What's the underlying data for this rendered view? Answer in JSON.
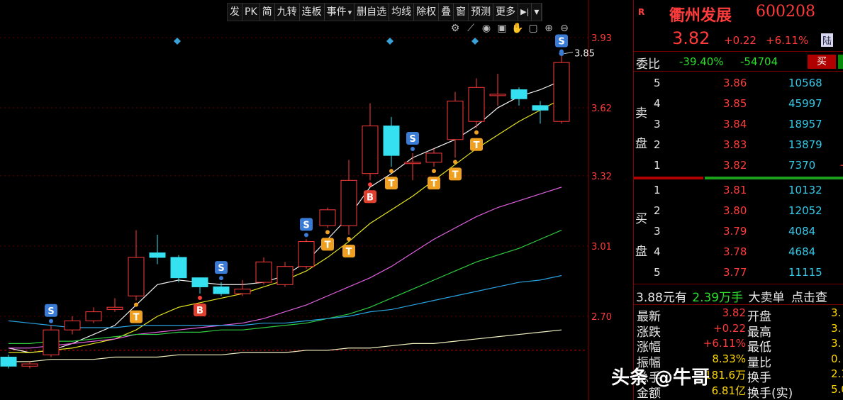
{
  "toolbar": {
    "items": [
      "发",
      "PK",
      "简",
      "九转",
      "连板",
      "事件",
      "删自选",
      "均线",
      "除权",
      "叠",
      "窗",
      "预测",
      "更多"
    ],
    "menu_icon": "dropdown-triangle-icon",
    "collapse_icon": "collapse-right-icon"
  },
  "chart_icons": [
    "gear-icon",
    "brush-icon",
    "eye-icon",
    "case-icon",
    "hand-icon",
    "lock-icon",
    "zoom-in-icon",
    "zoom-out-icon"
  ],
  "chart_data": {
    "type": "candlestick",
    "y_ticks": [
      "3.93",
      "3.62",
      "3.32",
      "3.01",
      "2.70"
    ],
    "ylim": [
      2.45,
      4.05
    ],
    "ref_price": 2.55,
    "high_label": "3.85",
    "colors": {
      "up": "#ff3b3b",
      "down": "#35e0f0",
      "background": "#000000",
      "grid": "#5a0000"
    },
    "candles": [
      [
        2.52,
        2.48,
        2.53,
        2.47
      ],
      [
        2.48,
        2.49,
        2.5,
        2.47
      ],
      [
        2.53,
        2.64,
        2.66,
        2.52
      ],
      [
        2.64,
        2.68,
        2.7,
        2.62
      ],
      [
        2.68,
        2.72,
        2.74,
        2.67
      ],
      [
        2.73,
        2.74,
        2.78,
        2.72
      ],
      [
        2.79,
        2.96,
        3.08,
        2.77
      ],
      [
        2.98,
        2.96,
        3.06,
        2.93
      ],
      [
        2.96,
        2.87,
        2.97,
        2.85
      ],
      [
        2.87,
        2.83,
        2.87,
        2.8
      ],
      [
        2.83,
        2.8,
        2.85,
        2.79
      ],
      [
        2.8,
        2.82,
        2.86,
        2.79
      ],
      [
        2.85,
        2.94,
        2.96,
        2.84
      ],
      [
        2.84,
        2.92,
        2.94,
        2.83
      ],
      [
        2.92,
        3.03,
        3.04,
        2.91
      ],
      [
        3.1,
        3.17,
        3.18,
        3.09
      ],
      [
        3.1,
        3.3,
        3.39,
        3.06
      ],
      [
        3.33,
        3.54,
        3.64,
        3.3
      ],
      [
        3.54,
        3.41,
        3.58,
        3.36
      ],
      [
        3.38,
        3.38,
        3.42,
        3.3
      ],
      [
        3.38,
        3.42,
        3.44,
        3.36
      ],
      [
        3.48,
        3.65,
        3.69,
        3.4
      ],
      [
        3.56,
        3.71,
        3.75,
        3.53
      ],
      [
        3.68,
        3.68,
        3.77,
        3.63
      ],
      [
        3.7,
        3.66,
        3.71,
        3.63
      ],
      [
        3.63,
        3.61,
        3.65,
        3.55
      ],
      [
        3.56,
        3.82,
        3.85,
        3.55
      ]
    ],
    "ma_series": [
      {
        "color": "#f2f2f2",
        "values": [
          2.56,
          2.54,
          2.55,
          2.58,
          2.62,
          2.66,
          2.75,
          2.84,
          2.86,
          2.85,
          2.84,
          2.84,
          2.85,
          2.88,
          2.94,
          3.04,
          3.14,
          3.27,
          3.33,
          3.4,
          3.44,
          3.48,
          3.54,
          3.62,
          3.67,
          3.7,
          3.74
        ]
      },
      {
        "color": "#e6e61e",
        "values": [
          2.54,
          2.54,
          2.55,
          2.56,
          2.58,
          2.6,
          2.64,
          2.7,
          2.74,
          2.76,
          2.78,
          2.8,
          2.83,
          2.86,
          2.9,
          2.96,
          3.03,
          3.11,
          3.17,
          3.23,
          3.3,
          3.37,
          3.44,
          3.5,
          3.56,
          3.61,
          3.66
        ]
      },
      {
        "color": "#e060e0",
        "values": [
          2.56,
          2.56,
          2.57,
          2.58,
          2.59,
          2.6,
          2.62,
          2.63,
          2.64,
          2.65,
          2.66,
          2.67,
          2.69,
          2.72,
          2.75,
          2.79,
          2.83,
          2.87,
          2.92,
          2.98,
          3.04,
          3.09,
          3.14,
          3.18,
          3.21,
          3.24,
          3.27
        ]
      },
      {
        "color": "#2ecc40",
        "values": [
          2.58,
          2.58,
          2.59,
          2.59,
          2.6,
          2.61,
          2.62,
          2.62,
          2.63,
          2.63,
          2.64,
          2.64,
          2.65,
          2.66,
          2.67,
          2.69,
          2.71,
          2.74,
          2.78,
          2.82,
          2.86,
          2.9,
          2.94,
          2.97,
          3.0,
          3.04,
          3.08
        ]
      },
      {
        "color": "#29a3e0",
        "values": [
          2.68,
          2.67,
          2.66,
          2.65,
          2.65,
          2.65,
          2.66,
          2.66,
          2.66,
          2.66,
          2.66,
          2.66,
          2.67,
          2.67,
          2.68,
          2.69,
          2.7,
          2.72,
          2.73,
          2.75,
          2.77,
          2.79,
          2.81,
          2.83,
          2.85,
          2.86,
          2.88
        ]
      },
      {
        "color": "#f0f0c0",
        "values": [
          2.5,
          2.5,
          2.51,
          2.51,
          2.51,
          2.52,
          2.52,
          2.52,
          2.53,
          2.53,
          2.53,
          2.54,
          2.54,
          2.54,
          2.55,
          2.55,
          2.56,
          2.56,
          2.57,
          2.58,
          2.58,
          2.59,
          2.6,
          2.61,
          2.62,
          2.63,
          2.64
        ]
      }
    ],
    "signals": [
      {
        "i": 2,
        "label": "S",
        "pos": "above"
      },
      {
        "i": 6,
        "label": "T",
        "pos": "below"
      },
      {
        "i": 9,
        "label": "B",
        "pos": "below"
      },
      {
        "i": 10,
        "label": "S",
        "pos": "above"
      },
      {
        "i": 14,
        "label": "S",
        "pos": "above"
      },
      {
        "i": 15,
        "label": "T",
        "pos": "below"
      },
      {
        "i": 16,
        "label": "T",
        "pos": "below"
      },
      {
        "i": 17,
        "label": "B",
        "pos": "below"
      },
      {
        "i": 18,
        "label": "T",
        "pos": "below"
      },
      {
        "i": 19,
        "label": "S",
        "pos": "above"
      },
      {
        "i": 20,
        "label": "T",
        "pos": "below"
      },
      {
        "i": 21,
        "label": "T",
        "pos": "below"
      },
      {
        "i": 22,
        "label": "T",
        "pos": "below"
      },
      {
        "i": 26,
        "label": "S",
        "pos": "above"
      }
    ],
    "diamond_markers_at": [
      8,
      18,
      22
    ]
  },
  "quote": {
    "market_tag": "R",
    "name": "衢州发展",
    "code": "600208",
    "price": "3.82",
    "change": "+0.22",
    "change_pct": "+6.11%",
    "channel_badge": "陆",
    "committee_label": "委比",
    "committee_pct": "-39.40%",
    "committee_diff": "-54704",
    "buy_button": "买",
    "sell_button": "卖"
  },
  "order_book": {
    "sell_label": [
      "卖",
      "盘"
    ],
    "buy_label": [
      "买",
      "盘"
    ],
    "asks": [
      {
        "level": "5",
        "price": "3.86",
        "volume": "10568"
      },
      {
        "level": "4",
        "price": "3.85",
        "volume": "45997"
      },
      {
        "level": "3",
        "price": "3.84",
        "volume": "18957"
      },
      {
        "level": "2",
        "price": "3.83",
        "volume": "13879"
      },
      {
        "level": "1",
        "price": "3.82",
        "volume": "7370",
        "extra": "+"
      }
    ],
    "bids": [
      {
        "level": "1",
        "price": "3.81",
        "volume": "10132"
      },
      {
        "level": "2",
        "price": "3.80",
        "volume": "12052"
      },
      {
        "level": "3",
        "price": "3.79",
        "volume": "4084"
      },
      {
        "level": "4",
        "price": "3.78",
        "volume": "4684"
      },
      {
        "level": "5",
        "price": "3.77",
        "volume": "11115"
      }
    ]
  },
  "big_order": {
    "price_text": "3.88",
    "unit_text": "元有",
    "amount": "2.39万手",
    "label": "大卖单",
    "link": "点击查"
  },
  "stats": [
    {
      "l1": "最新",
      "v1": "3.82",
      "c1": "red",
      "l2": "开盘",
      "v2": "3."
    },
    {
      "l1": "涨跌",
      "v1": "+0.22",
      "c1": "red",
      "l2": "最高",
      "v2": "3."
    },
    {
      "l1": "涨幅",
      "v1": "+6.11%",
      "c1": "red",
      "l2": "最低",
      "v2": "3."
    },
    {
      "l1": "振幅",
      "v1": "8.33%",
      "c1": "yellow",
      "l2": "量比",
      "v2": "0."
    },
    {
      "l1": "总手",
      "v1": "181.6万",
      "c1": "yellow",
      "l2": "换手",
      "v2": "2.1"
    },
    {
      "l1": "金额",
      "v1": "6.81亿",
      "c1": "yellow",
      "l2": "换手(实)",
      "v2": "5.0"
    }
  ],
  "watermark": "头条 @牛哥"
}
